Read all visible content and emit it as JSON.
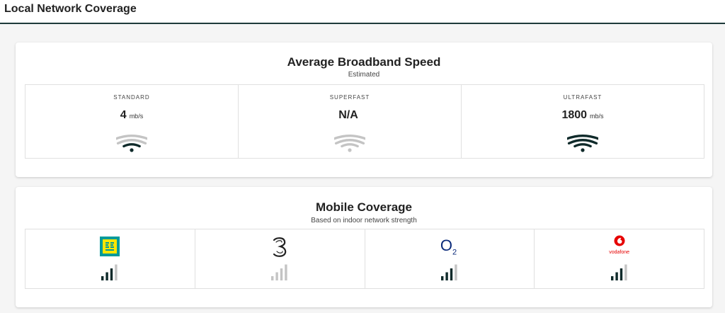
{
  "header": {
    "title": "Local Network Coverage"
  },
  "broadband": {
    "title": "Average Broadband Speed",
    "subtitle": "Estimated",
    "tiers": [
      {
        "label": "STANDARD",
        "value": "4",
        "unit": "mb/s",
        "signal_level": 1
      },
      {
        "label": "SUPERFAST",
        "value": "N/A",
        "unit": "",
        "signal_level": 0
      },
      {
        "label": "ULTRAFAST",
        "value": "1800",
        "unit": "mb/s",
        "signal_level": 3
      }
    ]
  },
  "mobile": {
    "title": "Mobile Coverage",
    "subtitle": "Based on indoor network strength",
    "operators": [
      {
        "name": "EE",
        "logo_icon": "ee-logo-icon",
        "signal_bars": 3,
        "max_bars": 4
      },
      {
        "name": "Three",
        "logo_icon": "three-logo-icon",
        "signal_bars": 0,
        "max_bars": 4
      },
      {
        "name": "O2",
        "logo_text": "O",
        "logo_sub": "2",
        "logo_icon": "o2-logo-icon",
        "signal_bars": 3,
        "max_bars": 4
      },
      {
        "name": "Vodafone",
        "logo_text": "vodafone",
        "logo_icon": "vodafone-logo-icon",
        "signal_bars": 3,
        "max_bars": 4
      }
    ]
  },
  "colors": {
    "active": "#0f2a2a",
    "inactive": "#c4c4c4",
    "ee_yellow": "#ffe600",
    "ee_teal": "#009a9a",
    "o2_blue": "#0a2a7a",
    "vodafone_red": "#e60000"
  }
}
